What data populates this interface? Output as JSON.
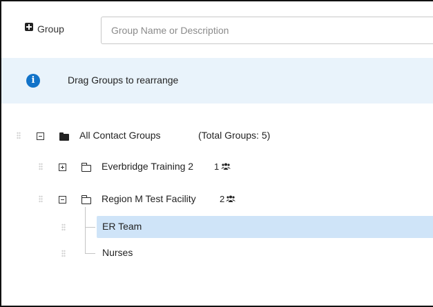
{
  "toolbar": {
    "group_button_label": "Group",
    "search_placeholder": "Group Name or Description",
    "search_value": ""
  },
  "info": {
    "message": "Drag Groups to rearrange",
    "icon_glyph": "i"
  },
  "tree": {
    "root": {
      "label": "All Contact Groups",
      "total_label": "(Total Groups: 5)",
      "expanded": true
    },
    "groups": [
      {
        "label": "Everbridge Training 2",
        "count": "1",
        "expanded": false
      },
      {
        "label": "Region M Test Facility",
        "count": "2",
        "expanded": true,
        "children": [
          {
            "label": "ER Team",
            "selected": true
          },
          {
            "label": "Nurses",
            "selected": false
          }
        ]
      }
    ]
  },
  "colors": {
    "accent": "#1273c9",
    "banner_bg": "#e9f3fb",
    "selected_bg": "#cfe4f8"
  }
}
